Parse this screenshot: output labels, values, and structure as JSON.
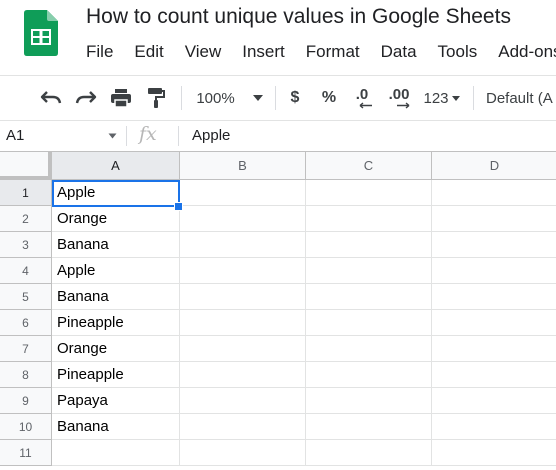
{
  "document": {
    "title": "How to count unique values in Google Sheets"
  },
  "menu": [
    "File",
    "Edit",
    "View",
    "Insert",
    "Format",
    "Data",
    "Tools",
    "Add-ons"
  ],
  "toolbar": {
    "zoom": "100%",
    "currency": "$",
    "percent": "%",
    "decrease_decimal": ".0",
    "increase_decimal": ".00",
    "more_formats": "123",
    "font": "Default (A"
  },
  "formula_bar": {
    "name_box": "A1",
    "fx": "fx",
    "value": "Apple"
  },
  "sheet": {
    "columns": [
      "A",
      "B",
      "C",
      "D"
    ],
    "row_numbers": [
      "1",
      "2",
      "3",
      "4",
      "5",
      "6",
      "7",
      "8",
      "9",
      "10",
      "11"
    ],
    "column_a": [
      "Apple",
      "Orange",
      "Banana",
      "Apple",
      "Banana",
      "Pineapple",
      "Orange",
      "Pineapple",
      "Papaya",
      "Banana",
      ""
    ],
    "active_cell": "A1"
  },
  "colors": {
    "logo_green": "#0f9d58",
    "selection_blue": "#1a73e8"
  }
}
